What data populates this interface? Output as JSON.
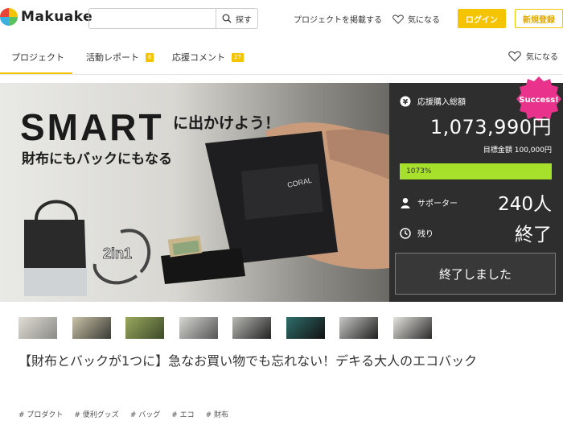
{
  "header": {
    "logo_text": "Makuake",
    "search_placeholder": "",
    "search_button": "探す",
    "post_project": "プロジェクトを掲載する",
    "favorite": "気になる",
    "login": "ログイン",
    "register": "新規登録"
  },
  "tabs": [
    {
      "label": "プロジェクト",
      "badge": ""
    },
    {
      "label": "活動レポート",
      "badge": "6"
    },
    {
      "label": "応援コメント",
      "badge": "27"
    }
  ],
  "tabs_favorite": "気になる",
  "hero": {
    "headline": "SMART",
    "headline_jp": "に出かけよう！",
    "sub": "財布にもバックにもなる",
    "brand": "CORAL",
    "badge_2in1": "2in1"
  },
  "funding": {
    "success_badge": "Success!",
    "total_label": "応援購入総額",
    "total_amount": "1,073,990円",
    "goal_label": "目標金額 100,000円",
    "progress_text": "1073%",
    "progress_fraction": 1.0,
    "supporters_label": "サポーター",
    "supporters_value": "240人",
    "remaining_label": "残り",
    "remaining_value": "終了",
    "end_button": "終了しました"
  },
  "thumbnails": [
    "thumb-1",
    "thumb-2",
    "thumb-3",
    "thumb-4",
    "thumb-5",
    "thumb-6",
    "thumb-7",
    "thumb-8"
  ],
  "project": {
    "title": "【財布とバックが1つに】急なお買い物でも忘れない！デキる大人のエコバック",
    "tags": [
      "# プロダクト",
      "# 便利グッズ",
      "# バッグ",
      "# エコ",
      "# 財布"
    ]
  },
  "colors": {
    "accent": "#f5c400",
    "panel_bg": "#2e2e2e",
    "success_pink": "#e8328c",
    "progress_green": "#a6e02b"
  }
}
